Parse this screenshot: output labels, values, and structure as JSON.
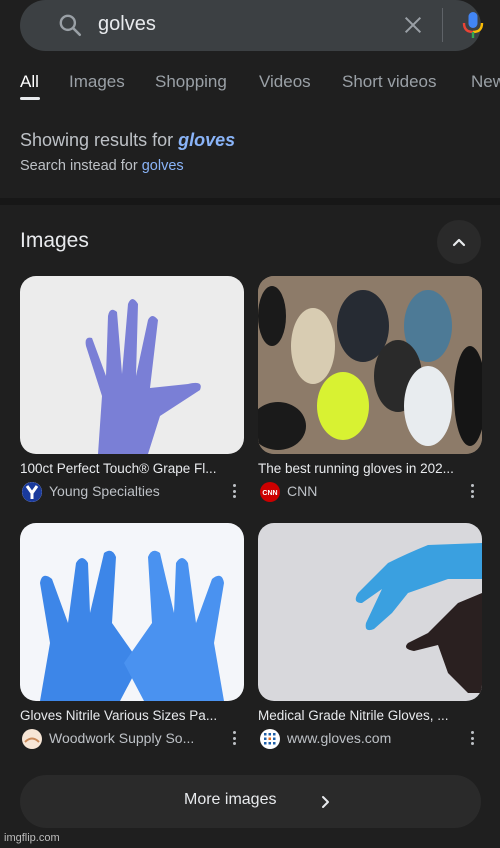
{
  "search": {
    "query": "golves",
    "icons": {
      "search": "search-icon",
      "clear": "close-icon",
      "voice": "mic-icon"
    }
  },
  "tabs": [
    {
      "label": "All",
      "active": true
    },
    {
      "label": "Images",
      "active": false
    },
    {
      "label": "Shopping",
      "active": false
    },
    {
      "label": "Videos",
      "active": false
    },
    {
      "label": "Short videos",
      "active": false
    },
    {
      "label": "News",
      "active": false
    }
  ],
  "spelling": {
    "showing_prefix": "Showing results for",
    "corrected_query": "gloves",
    "instead_prefix": "Search instead for",
    "original_query": "golves"
  },
  "images_section": {
    "title": "Images",
    "collapse_icon": "chevron-up-icon",
    "results": [
      {
        "caption": "100ct Perfect Touch® Grape Fl...",
        "source": "Young Specialties",
        "favicon": "young-specialties-logo",
        "image": "purple-nitrile-glove"
      },
      {
        "caption": "The best running gloves in 202...",
        "source": "CNN",
        "favicon": "cnn-logo",
        "image": "running-gloves-assortment"
      },
      {
        "caption": "Gloves Nitrile Various Sizes Pa...",
        "source": "Woodwork Supply So...",
        "favicon": "woodwork-supply-logo",
        "image": "blue-nitrile-gloves-hands"
      },
      {
        "caption": "Medical Grade Nitrile Gloves, ...",
        "source": "www.gloves.com",
        "favicon": "gloves-com-logo",
        "image": "blue-glove-being-put-on"
      }
    ],
    "more_button": "More images"
  },
  "watermark": "imgflip.com",
  "colors": {
    "background": "#1f1f1f",
    "search_bar": "#3c4043",
    "link": "#8ab4f8",
    "text_primary": "#e8eaed",
    "text_secondary": "#bdc1c6"
  }
}
